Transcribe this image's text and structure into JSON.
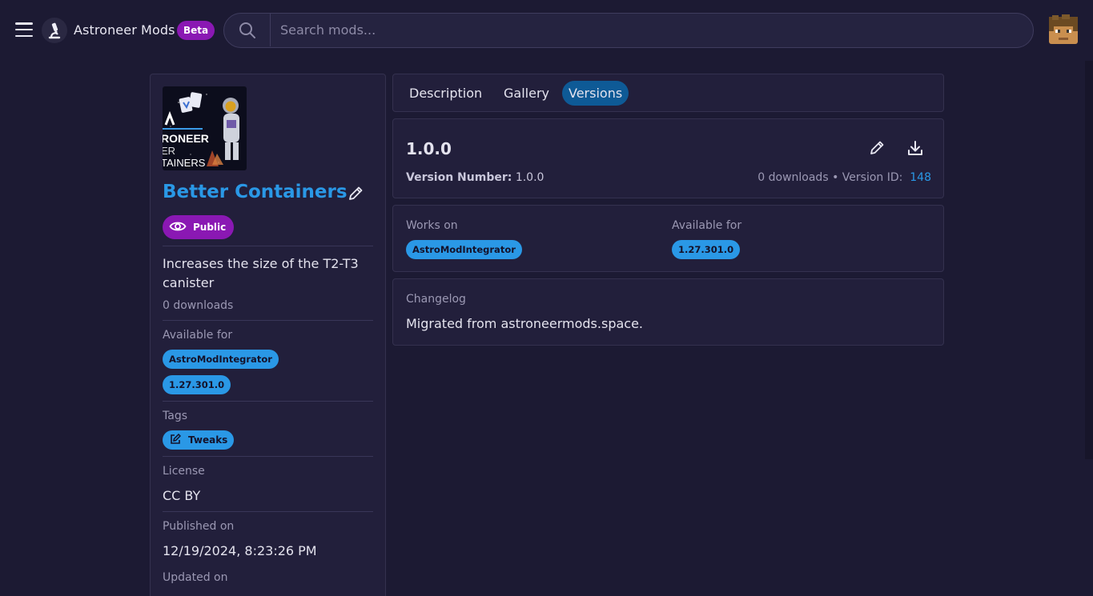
{
  "header": {
    "brand": "Astroneer Mods",
    "beta_label": "Beta",
    "search_placeholder": "Search mods..."
  },
  "mod": {
    "title": "Better Containers",
    "visibility": "Public",
    "description": "Increases the size of the T2-T3 canister",
    "downloads": "0 downloads",
    "available_for_label": "Available for",
    "available_for": [
      "AstroModIntegrator",
      "1.27.301.0"
    ],
    "tags_label": "Tags",
    "tags": [
      "Tweaks"
    ],
    "license_label": "License",
    "license": "CC BY",
    "published_label": "Published on",
    "published": "12/19/2024, 8:23:26 PM",
    "updated_label": "Updated on",
    "image_text": [
      "A",
      "RONEER",
      "ER",
      "TAINERS"
    ]
  },
  "tabs": [
    {
      "label": "Description",
      "active": false
    },
    {
      "label": "Gallery",
      "active": false
    },
    {
      "label": "Versions",
      "active": true
    }
  ],
  "version": {
    "title": "1.0.0",
    "number_label": "Version Number:",
    "number": "1.0.0",
    "downloads": "0 downloads",
    "separator": "•",
    "id_label": "Version ID:",
    "id": "148"
  },
  "compat": {
    "works_on_label": "Works on",
    "works_on": [
      "AstroModIntegrator"
    ],
    "available_for_label": "Available for",
    "available_for": [
      "1.27.301.0"
    ]
  },
  "changelog": {
    "label": "Changelog",
    "text": "Migrated from astroneermods.space."
  },
  "colors": {
    "background": "#1c1a33",
    "card": "#221f3b",
    "accent_blue": "#2a98e6",
    "accent_purple": "#8a18b3",
    "active_tab": "#0e5a96"
  },
  "icons": [
    "menu-icon",
    "microscope-logo-icon",
    "search-icon",
    "avatar-icon",
    "pencil-icon",
    "eye-icon",
    "edit-tag-icon",
    "download-icon"
  ]
}
